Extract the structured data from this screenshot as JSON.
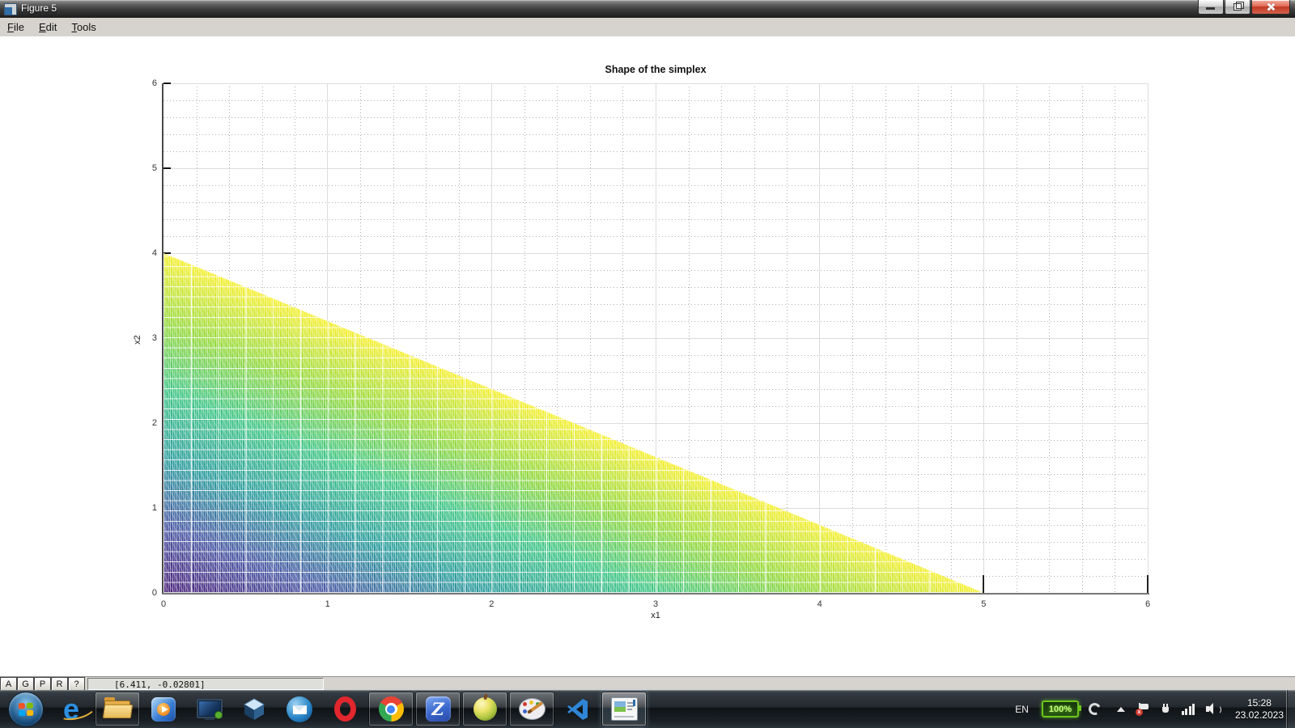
{
  "window": {
    "title": "Figure 5",
    "menu": [
      {
        "label": "File"
      },
      {
        "label": "Edit"
      },
      {
        "label": "Tools"
      }
    ],
    "controls": [
      "minimize",
      "restore",
      "close"
    ]
  },
  "chart_data": {
    "type": "area",
    "title": "Shape of the simplex",
    "xlabel": "x1",
    "ylabel": "x2",
    "xlim": [
      0,
      6
    ],
    "ylim": [
      0,
      6
    ],
    "xticks": [
      0,
      1,
      2,
      3,
      4,
      5,
      6
    ],
    "yticks": [
      0,
      1,
      2,
      3,
      4,
      5,
      6
    ],
    "minor_grid_step": 0.2,
    "grid": true,
    "legend": "none",
    "region": {
      "shape": "triangle",
      "vertices": [
        [
          0,
          0
        ],
        [
          5,
          0
        ],
        [
          0,
          4
        ]
      ],
      "description": "Feasible simplex bounded by x1/5 + x2/4 <= 1, x1 >= 0, x2 >= 0"
    },
    "colormap": {
      "value_function": "x1/5 + x2/4 (0 at origin, 1 on hypotenuse)",
      "stops": [
        "#4a2078",
        "#4b5aa5",
        "#2e9e9e",
        "#41c687",
        "#96d93c",
        "#f5ef30"
      ]
    }
  },
  "statusbar": {
    "buttons": [
      "A",
      "G",
      "P",
      "R",
      "?"
    ],
    "coordinates": "[6.411, -0.02801]"
  },
  "taskbar": {
    "icons": [
      "start-button",
      "internet-explorer",
      "file-explorer",
      "media-player",
      "remote-desktop",
      "virtualbox",
      "thunderbird",
      "opera",
      "chrome",
      "blue-z-app",
      "3d-ball-app",
      "paint-palette-app",
      "vs-code",
      "figure-window-preview"
    ],
    "glyphs": {
      "ie": "e",
      "zapp": "Z"
    },
    "tray": {
      "language": "EN",
      "battery": "100%",
      "time": "15:28",
      "date": "23.02.2023"
    }
  }
}
